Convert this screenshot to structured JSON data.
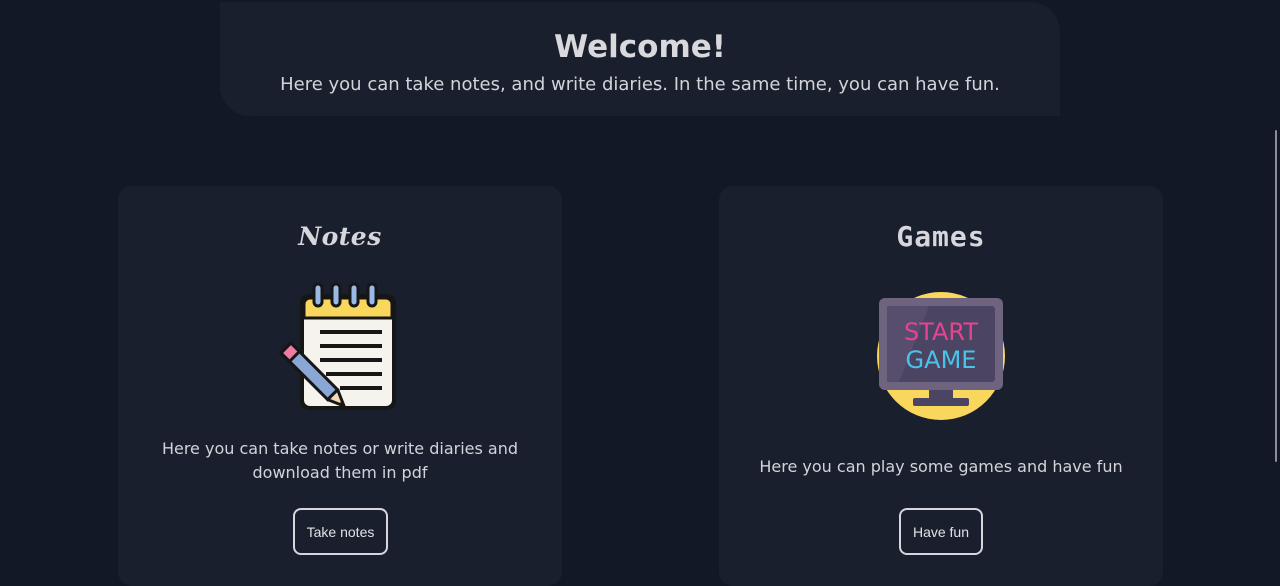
{
  "welcome": {
    "title": "Welcome!",
    "subtitle": "Here you can take notes, and write diaries. In the same time, you can have fun."
  },
  "cards": {
    "notes": {
      "title": "Notes",
      "icon": "notepad-pencil-icon",
      "description": "Here you can take notes or write diaries and download them in pdf",
      "button_label": "Take notes"
    },
    "games": {
      "title": "Games",
      "icon": "start-game-monitor-icon",
      "icon_text_line1": "START",
      "icon_text_line2": "GAME",
      "description": "Here you can play some games and have fun",
      "button_label": "Have fun"
    }
  },
  "colors": {
    "background": "#121826",
    "card": "#1a1f2e",
    "text": "#d6d8de",
    "accent_yellow": "#f9d65c",
    "accent_pink": "#e8438f",
    "accent_cyan": "#49c4e8"
  }
}
